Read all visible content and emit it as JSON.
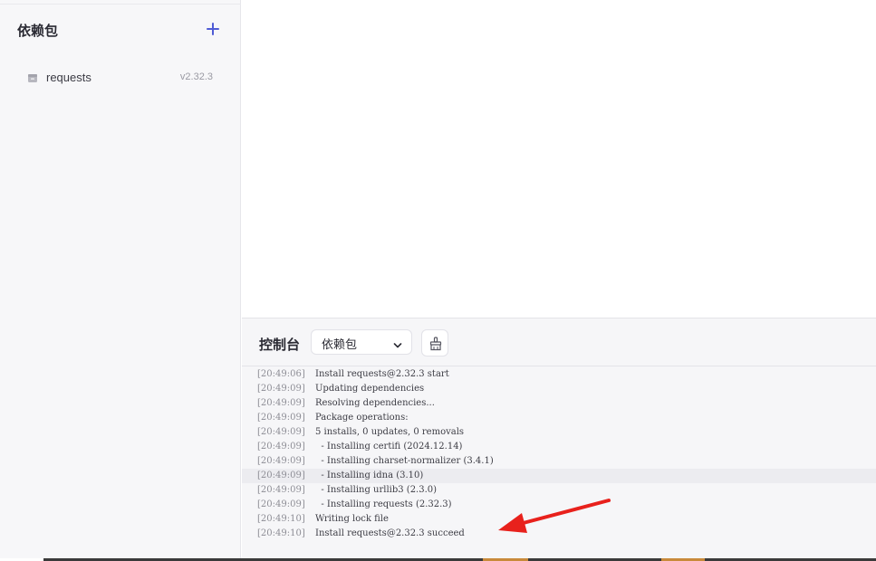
{
  "sidebar": {
    "title": "依赖包",
    "add_icon": "plus-icon",
    "items": [
      {
        "name": "requests",
        "version": "v2.32.3",
        "icon": "package-icon"
      }
    ]
  },
  "console": {
    "title": "控制台",
    "select": {
      "value": "依赖包",
      "icon": "chevron-down-icon"
    },
    "clear_icon": "broom-icon",
    "logs": [
      {
        "ts": "[20:49:06]",
        "msg": "Install requests@2.32.3 start"
      },
      {
        "ts": "[20:49:09]",
        "msg": "Updating dependencies"
      },
      {
        "ts": "[20:49:09]",
        "msg": "Resolving dependencies..."
      },
      {
        "ts": "[20:49:09]",
        "msg": "Package operations:"
      },
      {
        "ts": "[20:49:09]",
        "msg": "5 installs, 0 updates, 0 removals"
      },
      {
        "ts": "[20:49:09]",
        "msg": "  - Installing certifi (2024.12.14)"
      },
      {
        "ts": "[20:49:09]",
        "msg": "  - Installing charset-normalizer (3.4.1)"
      },
      {
        "ts": "[20:49:09]",
        "msg": "  - Installing idna (3.10)"
      },
      {
        "ts": "[20:49:09]",
        "msg": "  - Installing urllib3 (2.3.0)"
      },
      {
        "ts": "[20:49:09]",
        "msg": "  - Installing requests (2.32.3)"
      },
      {
        "ts": "[20:49:10]",
        "msg": "Writing lock file"
      },
      {
        "ts": "[20:49:10]",
        "msg": "Install requests@2.32.3 succeed"
      }
    ]
  },
  "colors": {
    "accent": "#4f5bd5",
    "annotation": "#e8211c"
  }
}
